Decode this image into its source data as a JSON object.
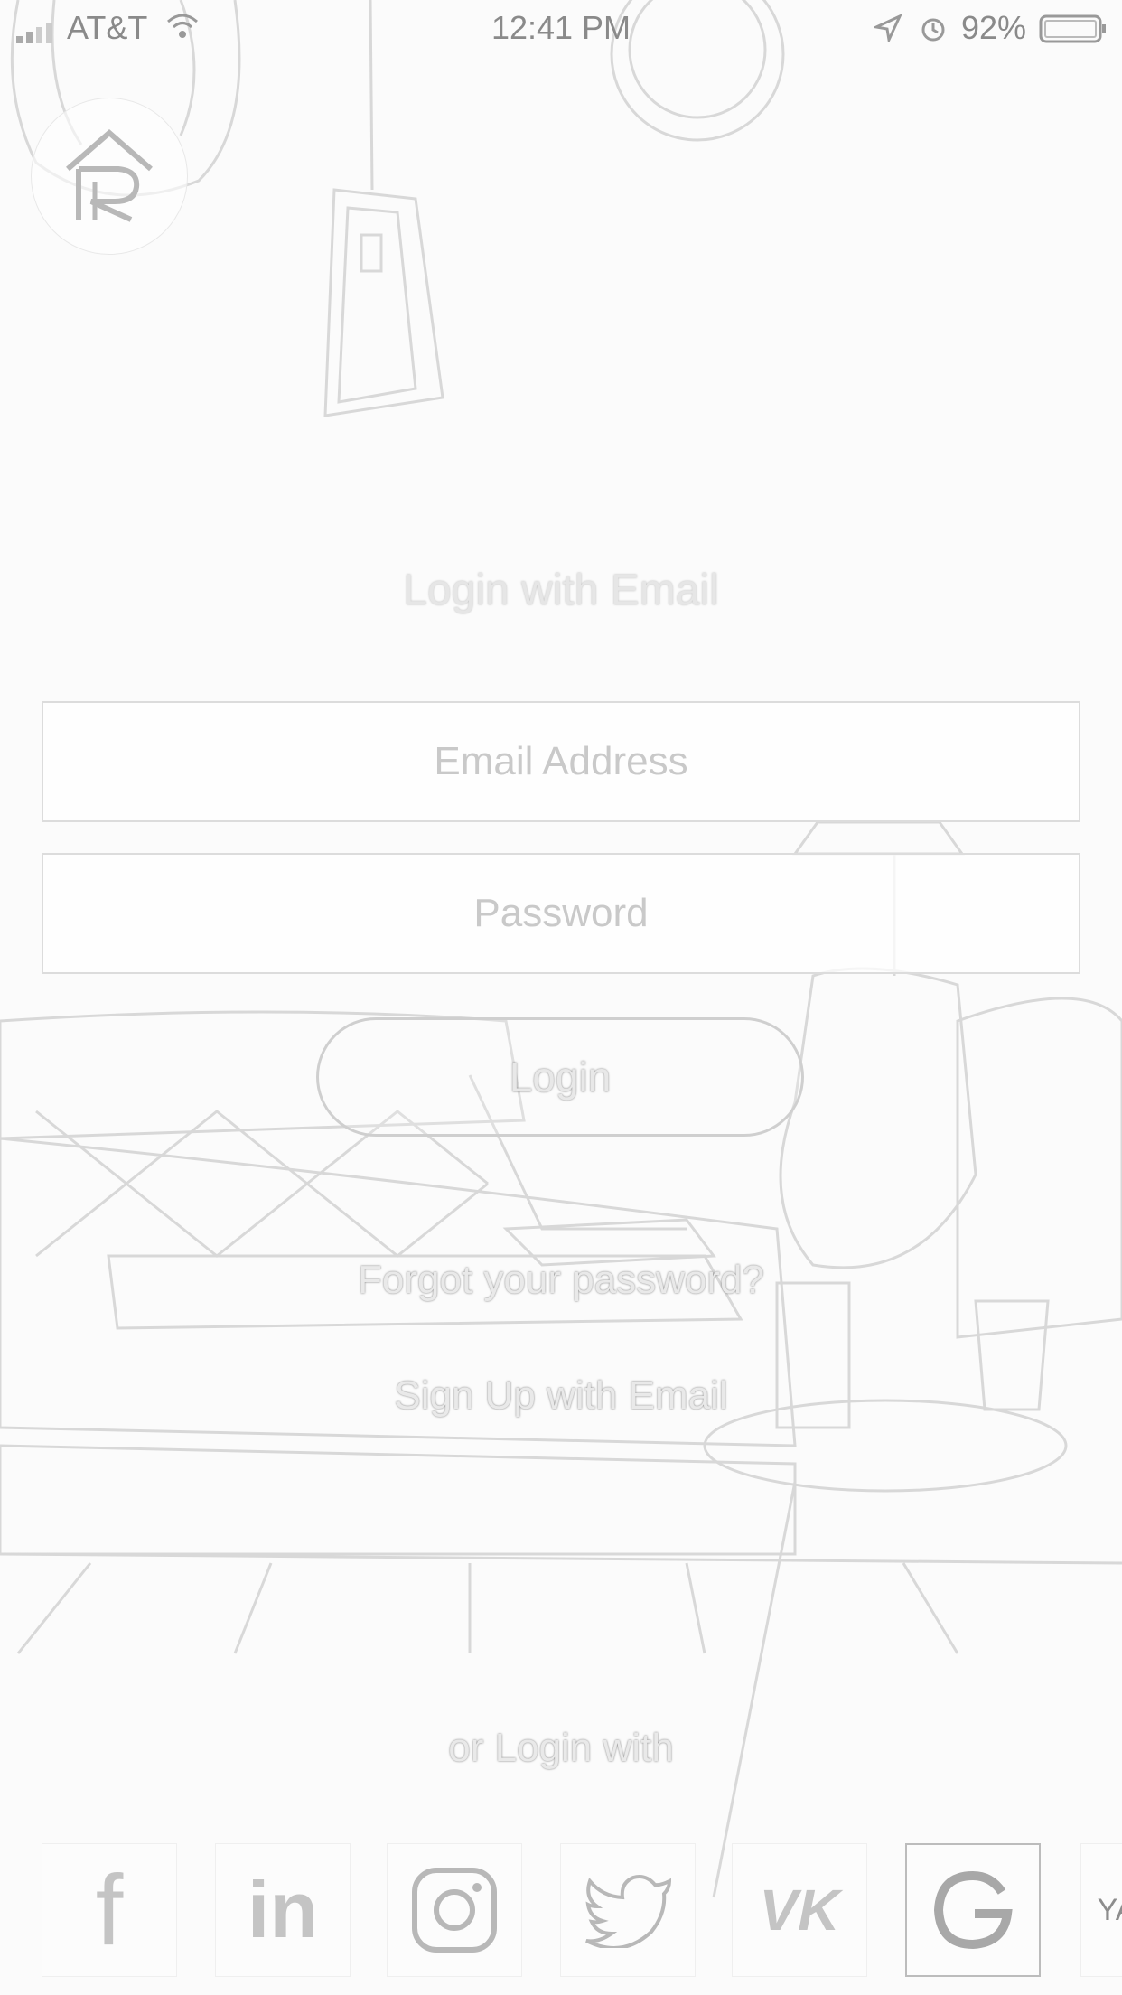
{
  "status_bar": {
    "carrier": "AT&T",
    "time": "12:41 PM",
    "battery": "92%"
  },
  "heading": "Login with Email",
  "email": {
    "placeholder": "Email Address"
  },
  "password": {
    "placeholder": "Password"
  },
  "login_button": "Login",
  "forgot_link": "Forgot your password?",
  "signup_link": "Sign Up with Email",
  "or_login_with": "or Login with",
  "social": [
    {
      "name": "facebook-icon",
      "glyph": "f"
    },
    {
      "name": "linkedin-icon",
      "glyph": "in"
    },
    {
      "name": "instagram-icon"
    },
    {
      "name": "twitter-icon"
    },
    {
      "name": "vk-icon",
      "glyph": "VK"
    },
    {
      "name": "google-icon",
      "glyph": "G"
    },
    {
      "name": "yandex-icon",
      "glyph": "YA"
    }
  ]
}
